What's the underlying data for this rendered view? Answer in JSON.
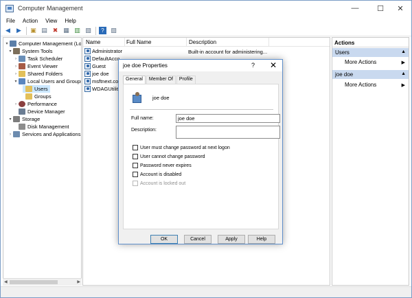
{
  "window": {
    "title": "Computer Management",
    "minimize": "—",
    "maximize": "☐",
    "close": "✕"
  },
  "menu": [
    "File",
    "Action",
    "View",
    "Help"
  ],
  "toolbar": {
    "icons": [
      "back-icon",
      "forward-icon",
      "up-folder-icon",
      "console-tree-icon",
      "delete-icon",
      "properties-icon",
      "refresh-icon",
      "export-list-icon",
      "help-icon",
      "show-hide-pane-icon"
    ]
  },
  "tree": [
    {
      "label": "Computer Management (Local",
      "level": 0,
      "expanded": "▾",
      "icon_color": "#5c7fa8"
    },
    {
      "label": "System Tools",
      "level": 1,
      "expanded": "▾",
      "icon_color": "#7c6f5a"
    },
    {
      "label": "Task Scheduler",
      "level": 2,
      "expanded": "›",
      "icon_color": "#6a8fb8"
    },
    {
      "label": "Event Viewer",
      "level": 2,
      "expanded": "›",
      "icon_color": "#a65b46"
    },
    {
      "label": "Shared Folders",
      "level": 2,
      "expanded": "›",
      "icon_color": "#e2c05a"
    },
    {
      "label": "Local Users and Groups",
      "level": 2,
      "expanded": "▾",
      "icon_color": "#5a86bf"
    },
    {
      "label": "Users",
      "level": 3,
      "expanded": "",
      "icon_color": "#e2c05a",
      "selected": true
    },
    {
      "label": "Groups",
      "level": 3,
      "expanded": "",
      "icon_color": "#e2c05a"
    },
    {
      "label": "Performance",
      "level": 2,
      "expanded": "›",
      "icon_color": "#8a3f3f"
    },
    {
      "label": "Device Manager",
      "level": 2,
      "expanded": "",
      "icon_color": "#6b7d93"
    },
    {
      "label": "Storage",
      "level": 1,
      "expanded": "▾",
      "icon_color": "#7d7d7d"
    },
    {
      "label": "Disk Management",
      "level": 2,
      "expanded": "",
      "icon_color": "#8d8d8d"
    },
    {
      "label": "Services and Applications",
      "level": 1,
      "expanded": "›",
      "icon_color": "#6d8caf"
    }
  ],
  "list": {
    "columns": [
      "Name",
      "Full Name",
      "Description"
    ],
    "rows": [
      {
        "name": "Administrator",
        "description": "Built-in account for administering..."
      },
      {
        "name": "DefaultAcco",
        "description": ""
      },
      {
        "name": "Guest",
        "description": ""
      },
      {
        "name": "joe doe",
        "description": ""
      },
      {
        "name": "msftnext.co",
        "description": ""
      },
      {
        "name": "WDAGUtility",
        "description": ""
      }
    ]
  },
  "actions": {
    "title": "Actions",
    "groups": [
      {
        "label": "Users",
        "item": "More Actions"
      },
      {
        "label": "joe doe",
        "item": "More Actions"
      }
    ]
  },
  "dialog": {
    "title": "joe doe Properties",
    "help": "?",
    "close": "✕",
    "tabs": [
      "General",
      "Member Of",
      "Profile"
    ],
    "username": "joe doe",
    "full_name_label": "Full name:",
    "full_name_value": "joe doe",
    "description_label": "Description:",
    "description_value": "",
    "checkboxes": [
      {
        "label": "User must change password at next logon",
        "checked": false,
        "disabled": false
      },
      {
        "label": "User cannot change password",
        "checked": false,
        "disabled": false
      },
      {
        "label": "Password never expires",
        "checked": false,
        "disabled": false
      },
      {
        "label": "Account is disabled",
        "checked": false,
        "disabled": false
      },
      {
        "label": "Account is locked out",
        "checked": false,
        "disabled": true
      }
    ],
    "buttons": {
      "ok": "OK",
      "cancel": "Cancel",
      "apply": "Apply",
      "help": "Help"
    }
  }
}
